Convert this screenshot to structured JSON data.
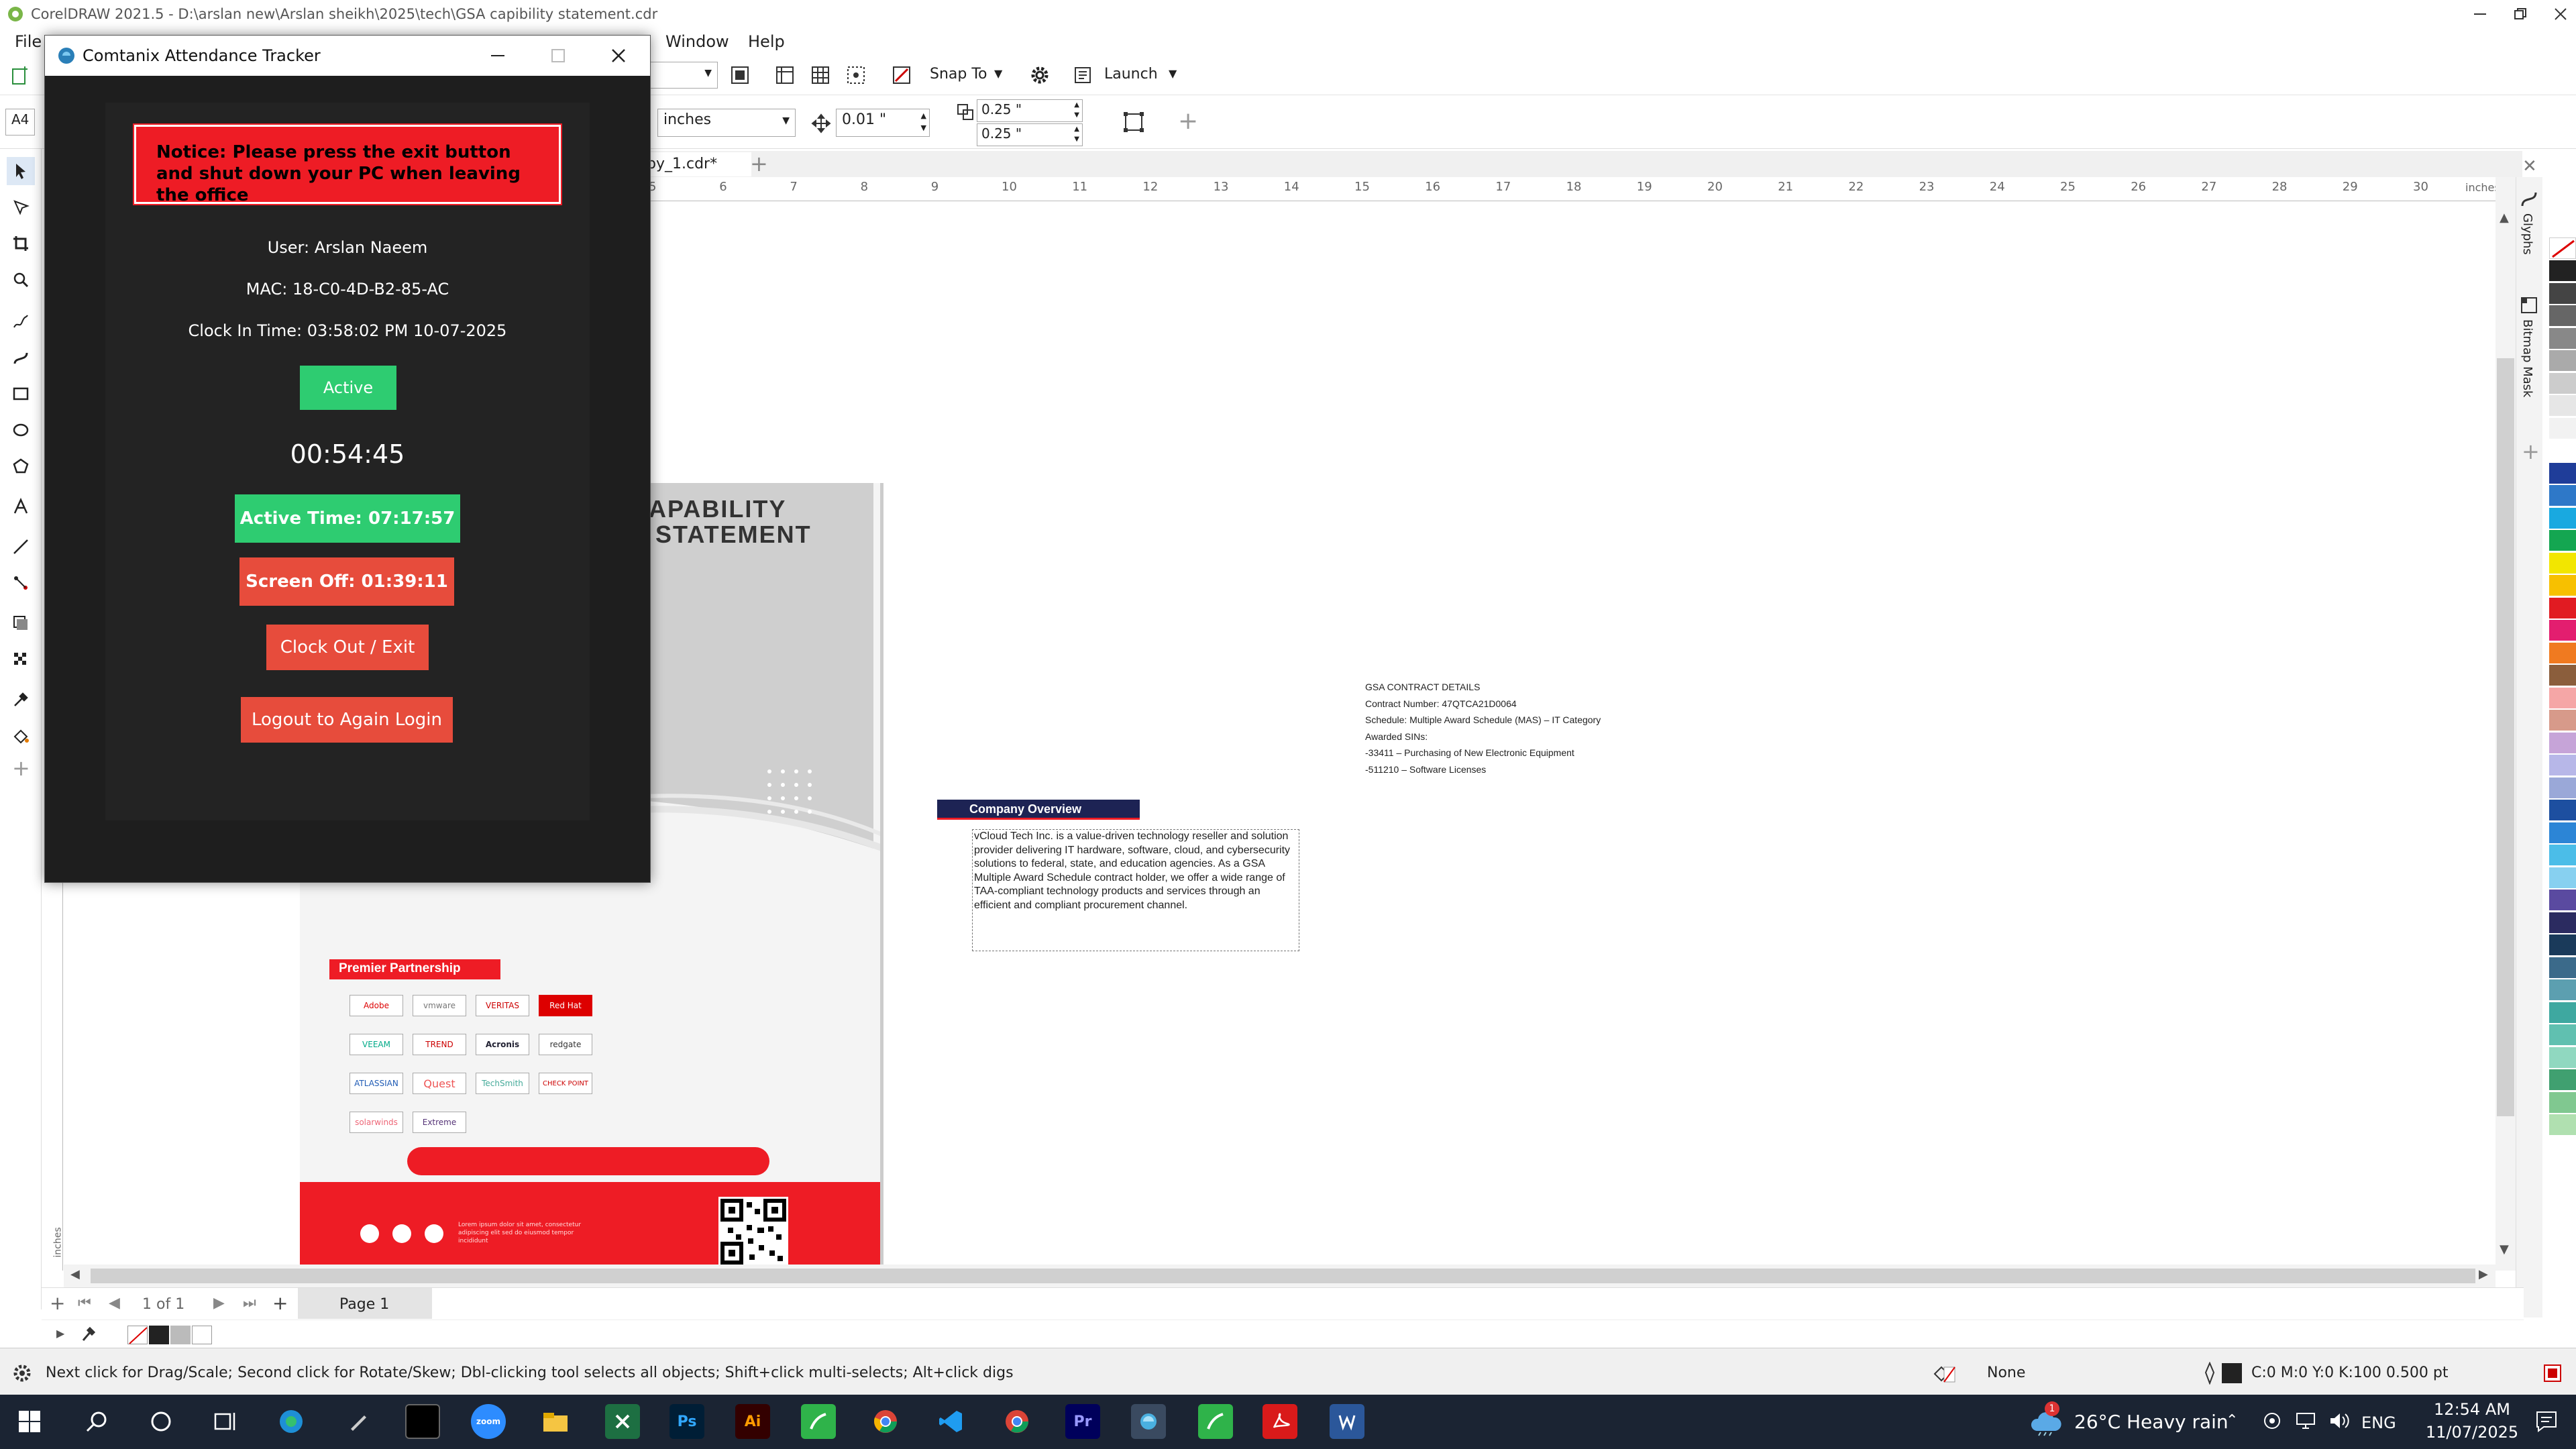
{
  "app": {
    "title": "CorelDRAW 2021.5 - D:\\arslan new\\Arslan sheikh\\2025\\tech\\GSA  capibility statement.cdr"
  },
  "menu": {
    "file": "File",
    "window": "Window",
    "help": "Help"
  },
  "toolbar": {
    "snap_to": "Snap To",
    "launch": "Launch",
    "page_size": "A4",
    "units": "inches",
    "nudge": "0.01 \"",
    "dup_x": "0.25 \"",
    "dup_y": "0.25 \""
  },
  "doc_tab": {
    "name": "py_1.cdr*"
  },
  "ruler": {
    "unit": "inches",
    "ticks": [
      "5",
      "6",
      "7",
      "8",
      "9",
      "10",
      "11",
      "12",
      "13",
      "14",
      "15",
      "16",
      "17",
      "18",
      "19",
      "20",
      "21",
      "22",
      "23",
      "24",
      "25",
      "26",
      "27",
      "28",
      "29",
      "30"
    ],
    "vunit": "inches"
  },
  "docker": {
    "glyphs": "Glyphs",
    "bitmap_mask": "Bitmap Mask"
  },
  "page_nav": {
    "counter": "1 of 1",
    "page_tab": "Page 1"
  },
  "status": {
    "hint": "Next click for Drag/Scale; Second click for Rotate/Skew; Dbl-clicking tool selects all objects; Shift+click multi-selects; Alt+click digs",
    "fill": "None",
    "outline": "C:0 M:0 Y:0 K:100  0.500 pt"
  },
  "doc": {
    "heading1": "APABILITY",
    "heading2": "STATEMENT",
    "premier": "Premier Partnership",
    "overview_title": "Company Overview",
    "overview_text": "vCloud Tech Inc. is a value-driven technology reseller and solution provider delivering IT hardware, software, cloud, and cybersecurity solutions to federal, state, and education agencies. As a GSA Multiple Award Schedule contract holder, we offer a wide range of TAA-compliant technology products and services through an efficient and compliant procurement channel.",
    "gsa_lines": [
      "GSA CONTRACT DETAILS",
      "Contract Number: 47QTCA21D0064",
      "Schedule: Multiple Award Schedule (MAS) – IT Category",
      "Awarded SINs:",
      "-33411 – Purchasing of New Electronic Equipment",
      "-511210 – Software Licenses"
    ],
    "logos": [
      "Adobe",
      "vmware",
      "VERITAS",
      "Red Hat",
      "VEEAM",
      "TREND",
      "Acronis",
      "redgate",
      "ATLASSIAN",
      "Quest",
      "TechSmith",
      "CHECK POINT",
      "solarwinds",
      "Extreme"
    ],
    "footer_text": "Lorem ipsum dolor sit amet, consectetur adipiscing elit sed do eiusmod tempor incididunt"
  },
  "tracker": {
    "title": "Comtanix Attendance Tracker",
    "notice": "Notice: Please press the exit button and shut down your PC when leaving the office",
    "user": "User: Arslan  Naeem",
    "mac": "MAC: 18-C0-4D-B2-85-AC",
    "clock_in": "Clock In Time: 03:58:02 PM 10-07-2025",
    "status": "Active",
    "timer": "00:54:45",
    "active_time": "Active Time: 07:17:57",
    "screen_off": "Screen Off: 01:39:11",
    "clock_out": "Clock Out / Exit",
    "logout": "Logout to Again Login"
  },
  "taskbar": {
    "weather_temp": "26°C",
    "weather_desc": "Heavy rain",
    "lang": "ENG",
    "time": "12:54 AM",
    "date": "11/07/2025",
    "zoom": "zoom",
    "ps": "Ps",
    "ai": "Ai",
    "pr": "Pr",
    "weather_badge": "1"
  },
  "colors": {
    "accent_red": "#ee1c25",
    "active_green": "#2ecc71",
    "button_red": "#e74c3c",
    "taskbar": "#1b2433",
    "overview_navy": "#1d2354"
  }
}
